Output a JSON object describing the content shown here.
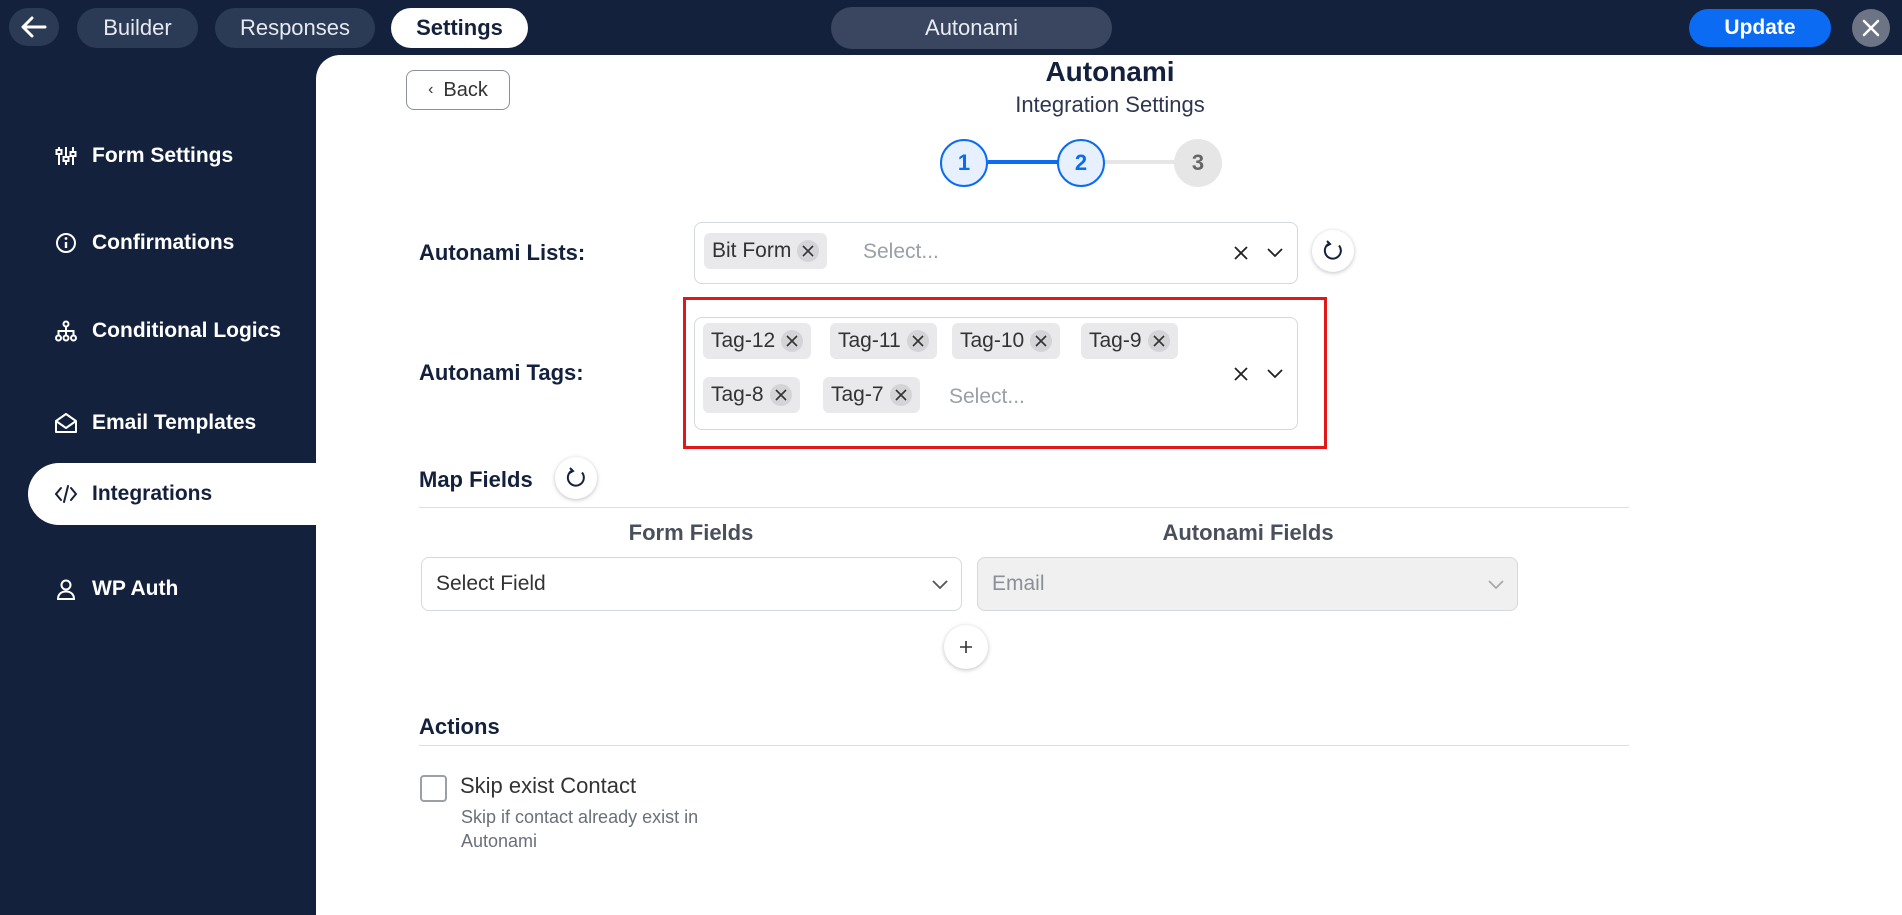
{
  "topbar": {
    "tabs": [
      {
        "label": "Builder",
        "active": false
      },
      {
        "label": "Responses",
        "active": false
      },
      {
        "label": "Settings",
        "active": true
      }
    ],
    "title": "Autonami",
    "update_label": "Update"
  },
  "sidebar": {
    "items": [
      {
        "label": "Form Settings",
        "icon": "sliders-icon",
        "active": false
      },
      {
        "label": "Confirmations",
        "icon": "info-icon",
        "active": false
      },
      {
        "label": "Conditional Logics",
        "icon": "sitemap-icon",
        "active": false
      },
      {
        "label": "Email Templates",
        "icon": "envelope-open-icon",
        "active": false
      },
      {
        "label": "Integrations",
        "icon": "code-icon",
        "active": true
      },
      {
        "label": "WP Auth",
        "icon": "user-icon",
        "active": false
      }
    ]
  },
  "main": {
    "back_label": "Back",
    "title": "Autonami",
    "subtitle": "Integration Settings",
    "steps": [
      {
        "label": "1",
        "state": "done"
      },
      {
        "label": "2",
        "state": "done"
      },
      {
        "label": "3",
        "state": "todo"
      }
    ],
    "lists": {
      "label": "Autonami Lists:",
      "selected": [
        "Bit Form"
      ],
      "placeholder": "Select..."
    },
    "tags": {
      "label": "Autonami Tags:",
      "selected": [
        "Tag-12",
        "Tag-11",
        "Tag-10",
        "Tag-9",
        "Tag-8",
        "Tag-7"
      ],
      "placeholder": "Select..."
    },
    "map_fields": {
      "title": "Map Fields",
      "form_fields_header": "Form Fields",
      "autonami_fields_header": "Autonami Fields",
      "form_field_value": "Select Field",
      "autonami_field_value": "Email"
    },
    "actions": {
      "title": "Actions",
      "skip_label": "Skip exist Contact",
      "skip_help": "Skip if contact already exist in Autonami",
      "skip_checked": false
    }
  },
  "colors": {
    "navy": "#14213d",
    "accent": "#0b6bf2",
    "highlight": "#e01818"
  }
}
